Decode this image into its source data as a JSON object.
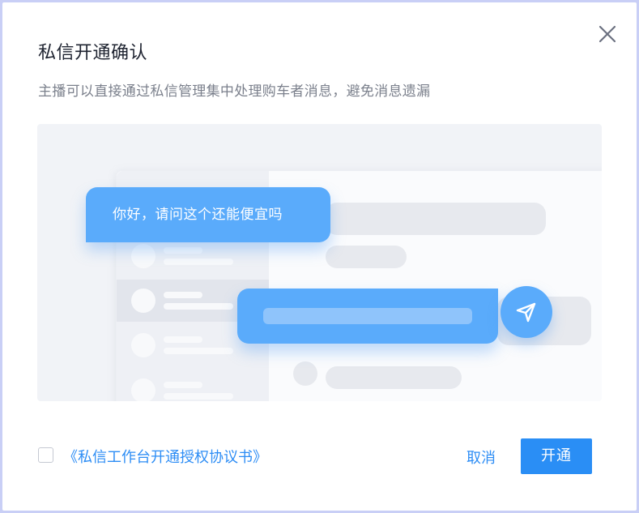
{
  "dialog": {
    "title": "私信开通确认",
    "subtitle": "主播可以直接通过私信管理集中处理购车者消息，避免消息遗漏",
    "close_icon": "close-icon"
  },
  "illustration": {
    "incoming_message": "你好，请问这个还能便宜吗",
    "send_icon": "send-icon",
    "accent_color": "#5aabfb"
  },
  "footer": {
    "agreement_checked": false,
    "agreement_label": "《私信工作台开通授权协议书》",
    "cancel_label": "取消",
    "confirm_label": "开通",
    "primary_color": "#2a8ef5",
    "link_color": "#2d8df5"
  }
}
